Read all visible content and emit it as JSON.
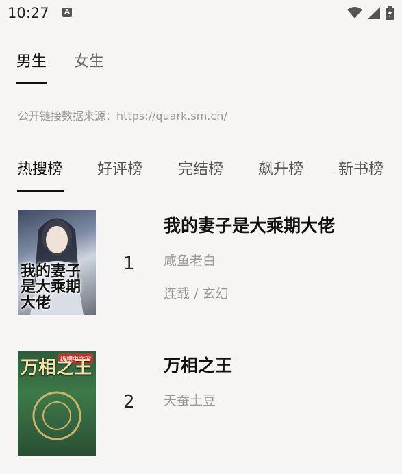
{
  "status_bar": {
    "time": "10:27",
    "notification_icon_label": "A",
    "icons": [
      "wifi-icon",
      "signal-icon",
      "battery-icon"
    ]
  },
  "gender_tabs": [
    {
      "label": "男生",
      "active": true
    },
    {
      "label": "女生",
      "active": false
    }
  ],
  "source_text": "公开链接数据来源：https://quark.sm.cn/",
  "rank_tabs": [
    {
      "label": "热搜榜",
      "active": true
    },
    {
      "label": "好评榜",
      "active": false
    },
    {
      "label": "完结榜",
      "active": false
    },
    {
      "label": "飙升榜",
      "active": false
    },
    {
      "label": "新书榜",
      "active": false
    }
  ],
  "books": [
    {
      "rank": "1",
      "title": "我的妻子是大乘期大佬",
      "author": "咸鱼老白",
      "meta": "连载 / 玄幻",
      "cover_text": "我的妻子是大乘期大佬"
    },
    {
      "rank": "2",
      "title": "万相之王",
      "author": "天蚕土豆",
      "meta": "",
      "cover_text": "万相之王",
      "cover_badge": "纵横中文网"
    }
  ],
  "colors": {
    "background": "#f6f5f3",
    "active_text": "#111111",
    "secondary_text": "#999999"
  }
}
